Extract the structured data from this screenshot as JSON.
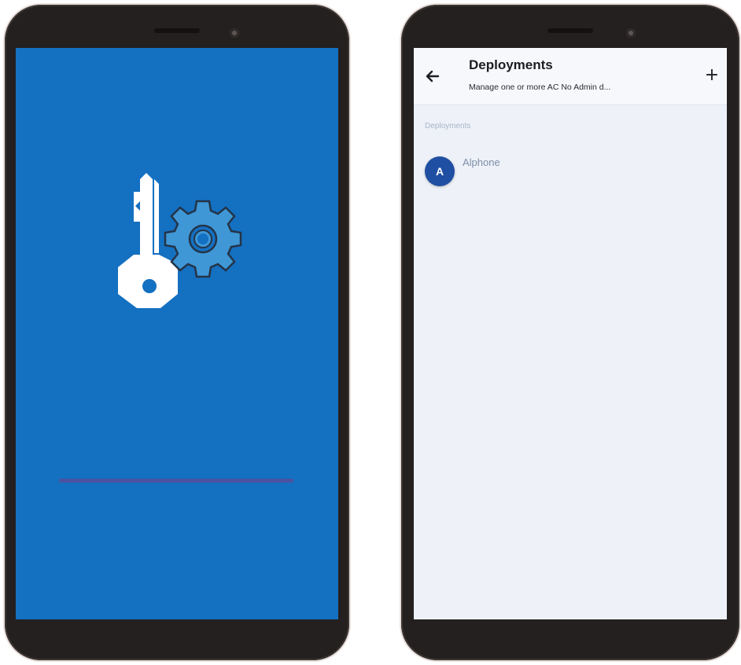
{
  "splash": {
    "progress_percent": 100,
    "colors": {
      "background": "#1470c1",
      "gear": "#3f97d6",
      "key": "#ffffff",
      "progress": "#4b53a0"
    },
    "icon": "key-gear-icon"
  },
  "deployments": {
    "title": "Deployments",
    "subtitle": "Manage one or more AC No Admin d...",
    "back_icon": "arrow-left-icon",
    "add_icon": "plus-icon",
    "add_label": "+",
    "section_label": "Deployments",
    "items": [
      {
        "avatar_letter": "A",
        "name": "Alphone"
      }
    ],
    "colors": {
      "avatar": "#1f4fa2",
      "background": "#eef2f8"
    }
  }
}
